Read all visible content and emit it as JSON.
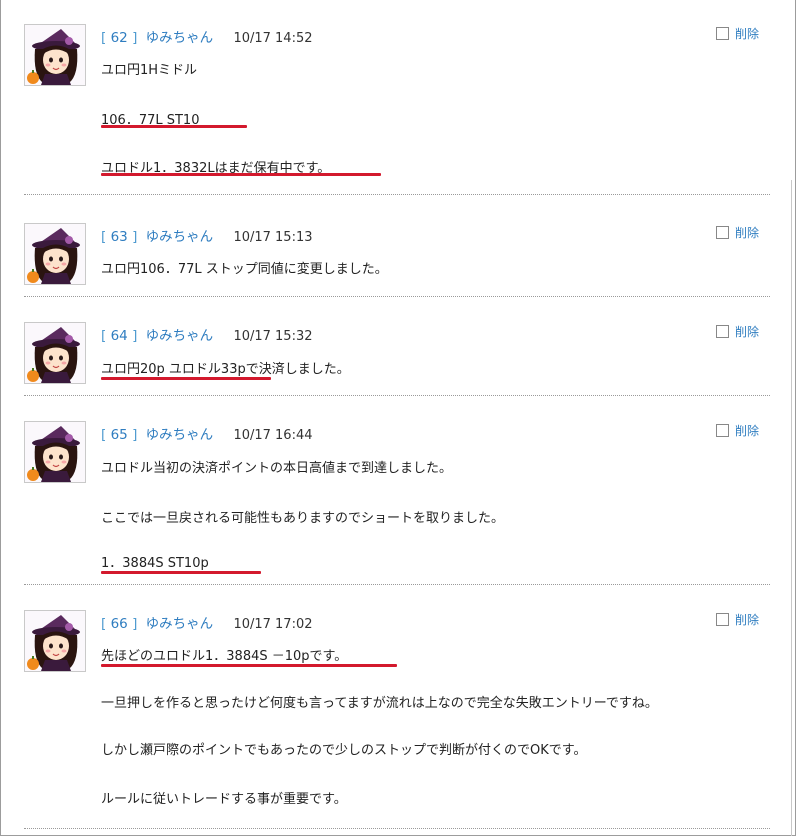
{
  "delete_label": "削除",
  "underline_color": "#d3192d",
  "link_color": "#2f7dc0",
  "posts": [
    {
      "number": "62",
      "author": "ゆみちゃん",
      "date": "10/17 14:52",
      "lines": [
        "ユロ円1Hミドル",
        "106．77L  ST10",
        "ユロドル1．3832Lはまだ保有中です。"
      ]
    },
    {
      "number": "63",
      "author": "ゆみちゃん",
      "date": "10/17 15:13",
      "lines": [
        "ユロ円106．77L ストップ同値に変更しました。"
      ]
    },
    {
      "number": "64",
      "author": "ゆみちゃん",
      "date": "10/17 15:32",
      "lines": [
        "ユロ円20p ユロドル33pで決済しました。"
      ]
    },
    {
      "number": "65",
      "author": "ゆみちゃん",
      "date": "10/17 16:44",
      "lines": [
        "ユロドル当初の決済ポイントの本日高値まで到達しました。",
        "ここでは一旦戻される可能性もありますのでショートを取りました。",
        "1．3884S  ST10p"
      ]
    },
    {
      "number": "66",
      "author": "ゆみちゃん",
      "date": "10/17 17:02",
      "lines": [
        "先ほどのユロドル1．3884S  －10pです。",
        "一旦押しを作ると思ったけど何度も言ってますが流れは上なので完全な失敗エントリーですね。",
        "しかし瀬戸際のポイントでもあったので少しのストップで判断が付くのでOKです。",
        "ルールに従いトレードする事が重要です。"
      ]
    }
  ]
}
